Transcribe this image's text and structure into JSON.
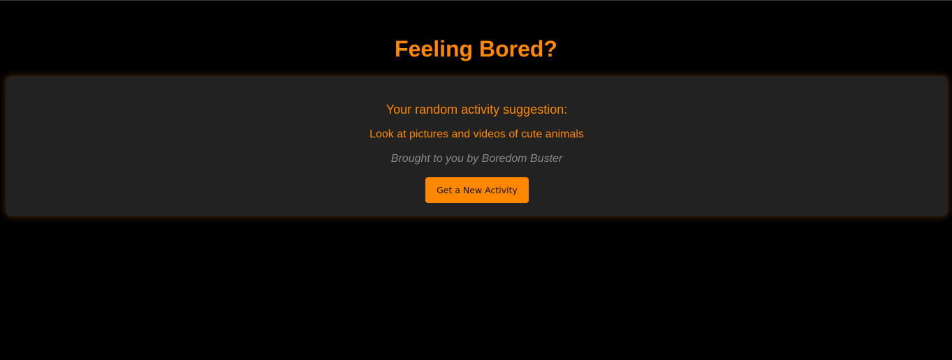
{
  "page": {
    "title": "Feeling Bored?"
  },
  "card": {
    "heading": "Your random activity suggestion:",
    "activity": "Look at pictures and videos of cute animals",
    "credit": "Brought to you by Boredom Buster",
    "button_label": "Get a New Activity"
  },
  "colors": {
    "background": "#000000",
    "card_background": "#222222",
    "accent": "#ff8800",
    "muted_text": "#888888",
    "button_text": "#111111"
  }
}
